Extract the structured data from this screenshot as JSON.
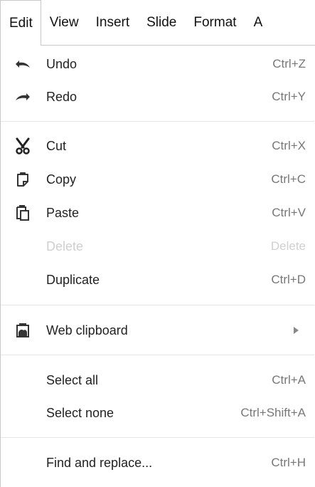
{
  "menubar": {
    "items": [
      {
        "label": "Edit"
      },
      {
        "label": "View"
      },
      {
        "label": "Insert"
      },
      {
        "label": "Slide"
      },
      {
        "label": "Format"
      },
      {
        "label": "A"
      }
    ],
    "active_index": 0
  },
  "edit_menu": {
    "undo": {
      "label": "Undo",
      "shortcut": "Ctrl+Z",
      "icon": "undo-icon"
    },
    "redo": {
      "label": "Redo",
      "shortcut": "Ctrl+Y",
      "icon": "redo-icon"
    },
    "cut": {
      "label": "Cut",
      "shortcut": "Ctrl+X",
      "icon": "scissors-icon"
    },
    "copy": {
      "label": "Copy",
      "shortcut": "Ctrl+C",
      "icon": "copy-icon"
    },
    "paste": {
      "label": "Paste",
      "shortcut": "Ctrl+V",
      "icon": "paste-icon"
    },
    "delete": {
      "label": "Delete",
      "shortcut": "Delete",
      "disabled": true
    },
    "duplicate": {
      "label": "Duplicate",
      "shortcut": "Ctrl+D"
    },
    "web_clipboard": {
      "label": "Web clipboard",
      "icon": "clipboard-icon",
      "has_submenu": true
    },
    "select_all": {
      "label": "Select all",
      "shortcut": "Ctrl+A"
    },
    "select_none": {
      "label": "Select none",
      "shortcut": "Ctrl+Shift+A"
    },
    "find_replace": {
      "label": "Find and replace...",
      "shortcut": "Ctrl+H"
    }
  },
  "colors": {
    "text": "#222222",
    "shortcut": "#777777",
    "disabled": "#cfcfcf",
    "separator": "#e5e5e5",
    "border": "#c8c8c8"
  }
}
